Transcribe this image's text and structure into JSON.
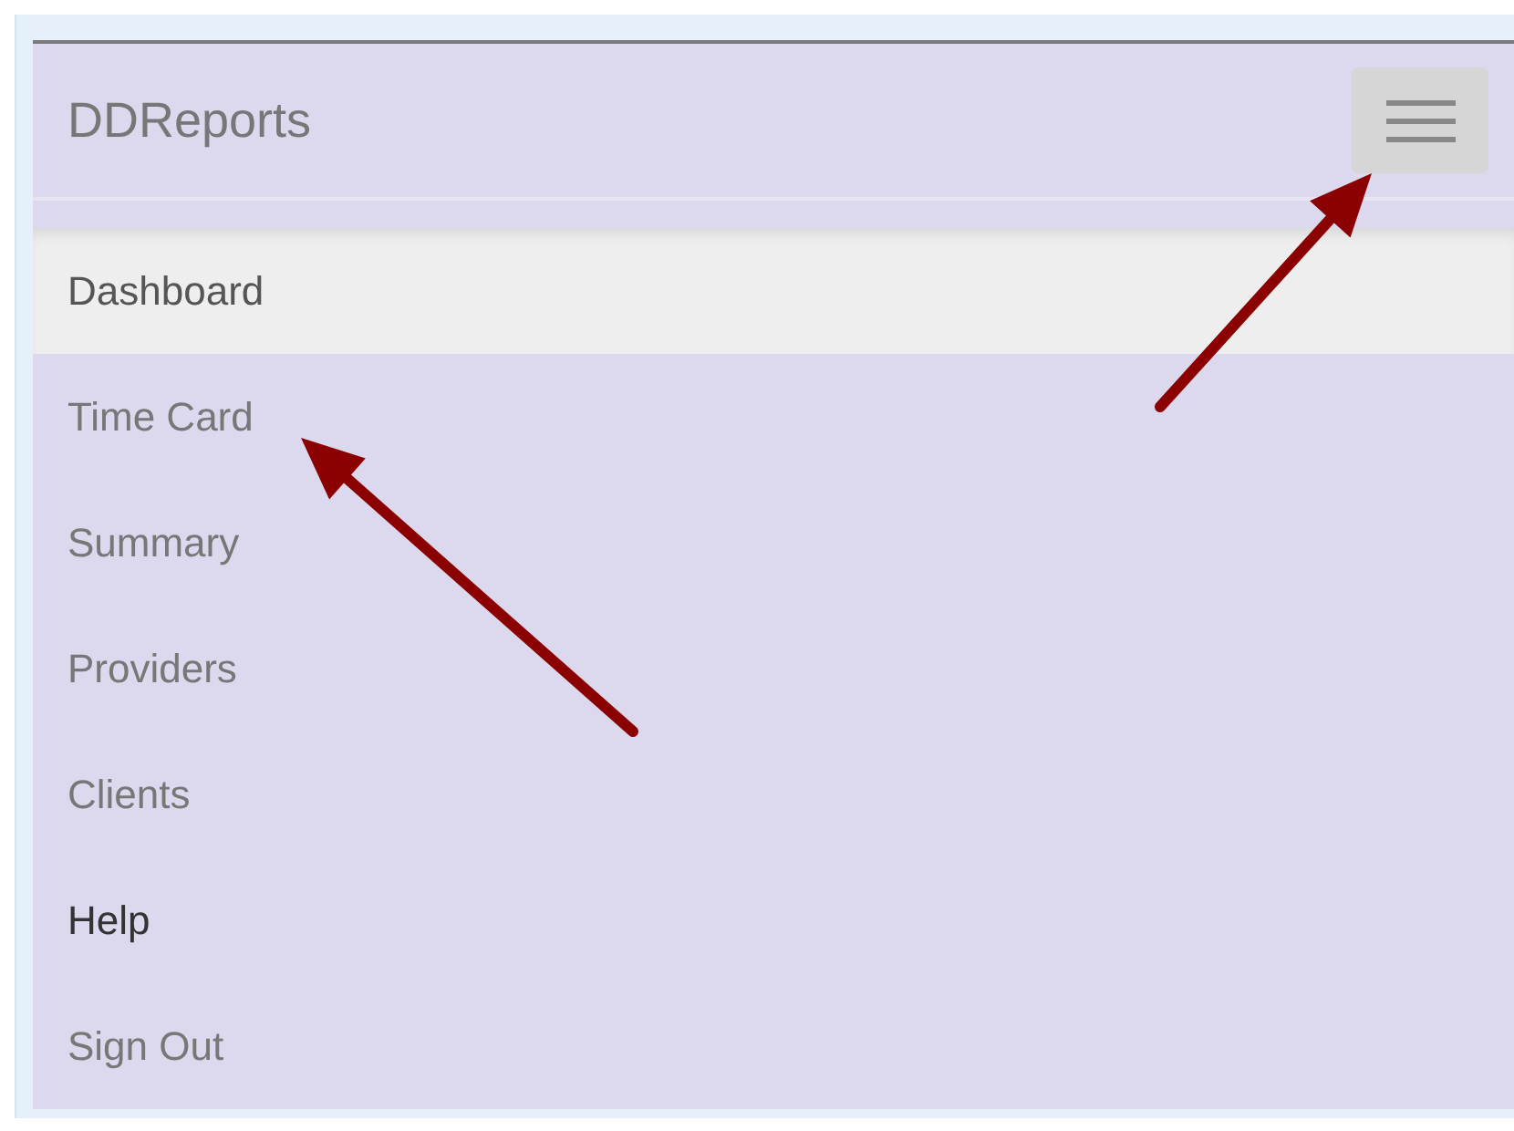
{
  "navbar": {
    "brand": "DDReports",
    "menu_button": {
      "expanded": true
    }
  },
  "menu": {
    "items": [
      {
        "label": "Dashboard",
        "selected": true,
        "hovered": false
      },
      {
        "label": "Time Card",
        "selected": false,
        "hovered": false
      },
      {
        "label": "Summary",
        "selected": false,
        "hovered": false
      },
      {
        "label": "Providers",
        "selected": false,
        "hovered": false
      },
      {
        "label": "Clients",
        "selected": false,
        "hovered": false
      },
      {
        "label": "Help",
        "selected": false,
        "hovered": true
      },
      {
        "label": "Sign Out",
        "selected": false,
        "hovered": false
      }
    ]
  }
}
